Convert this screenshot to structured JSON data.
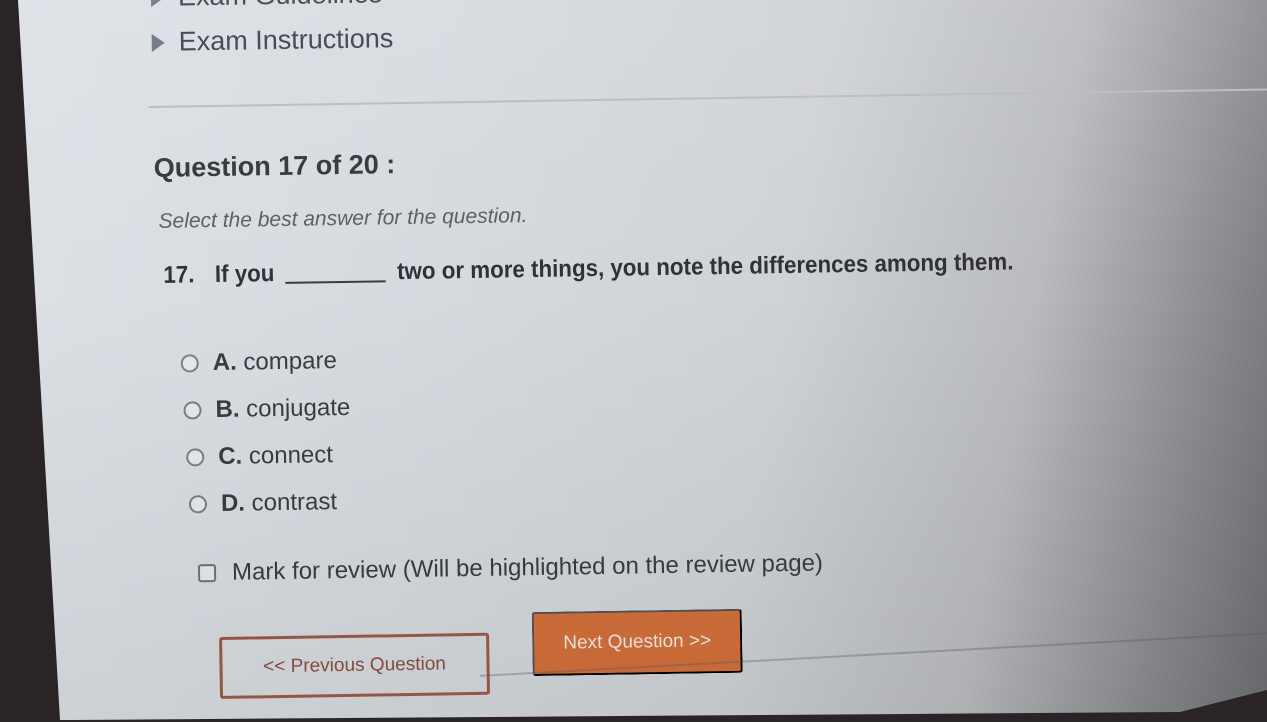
{
  "sections": [
    {
      "label": "Exam Guidelines",
      "icon": "triangle-right-icon"
    },
    {
      "label": "Exam Instructions",
      "icon": "triangle-right-icon"
    }
  ],
  "question": {
    "title": "Question 17 of 20 :",
    "current": 17,
    "total": 20,
    "instruction": "Select the best answer for the question.",
    "number": "17.",
    "text_before": "If you",
    "text_after": "two or more things, you note the differences among them."
  },
  "options": [
    {
      "letter": "A.",
      "text": "compare",
      "selected": false
    },
    {
      "letter": "B.",
      "text": "conjugate",
      "selected": false
    },
    {
      "letter": "C.",
      "text": "connect",
      "selected": false
    },
    {
      "letter": "D.",
      "text": "contrast",
      "selected": false
    }
  ],
  "review": {
    "label": "Mark for review (Will be highlighted on the review page)",
    "checked": false
  },
  "navigation": {
    "previous_label": "<< Previous Question",
    "next_label": "Next Question >>"
  },
  "colors": {
    "accent": "#d2703b",
    "prev_border": "#9e5a48"
  }
}
